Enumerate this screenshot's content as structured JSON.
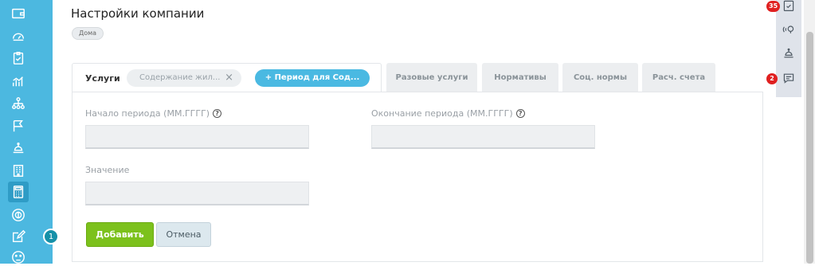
{
  "page": {
    "title": "Настройки компании",
    "tag": "Дома"
  },
  "tabs": {
    "active_label": "Услуги",
    "chip_label": "Содержание жил...",
    "chip_close": "×",
    "period_button": "+ Период для Сод...",
    "items": [
      "Разовые услуги",
      "Нормативы",
      "Соц. нормы",
      "Расч. счета"
    ]
  },
  "form": {
    "start_label": "Начало периода (ММ.ГГГГ)",
    "end_label": "Окончание периода (ММ.ГГГГ)",
    "value_label": "Значение",
    "help_glyph": "?",
    "start_value": "",
    "end_value": "",
    "value_value": "",
    "add_button": "Добавить",
    "cancel_button": "Отмена"
  },
  "sidebar": {
    "icons": [
      "wallet-icon",
      "meter-icon",
      "checklist-icon",
      "chart-icon",
      "hierarchy-icon",
      "flag-icon",
      "bell-service-icon",
      "building-icon",
      "calculator-icon",
      "target-icon",
      "edit-icon",
      "smiley-icon"
    ],
    "active": "calculator-icon",
    "badge": "1"
  },
  "rightbar": {
    "icons": [
      "tasks-icon",
      "signal-icon",
      "service-icon",
      "chat-icon"
    ],
    "tasks_badge": "35",
    "chat_badge": "2"
  },
  "colors": {
    "sidebar": "#4cb8e0",
    "accent": "#4ab9e2",
    "add_button": "#7cc11c",
    "badge_red": "#e02020"
  }
}
